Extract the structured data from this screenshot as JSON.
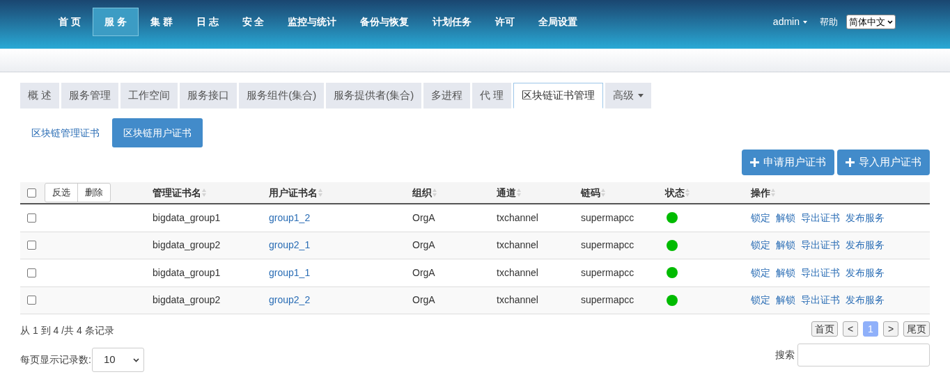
{
  "nav": {
    "items": [
      {
        "label": "首 页",
        "selected": false
      },
      {
        "label": "服 务",
        "selected": true
      },
      {
        "label": "集 群",
        "selected": false
      },
      {
        "label": "日 志",
        "selected": false
      },
      {
        "label": "安 全",
        "selected": false
      },
      {
        "label": "监控与统计",
        "selected": false
      },
      {
        "label": "备份与恢复",
        "selected": false
      },
      {
        "label": "计划任务",
        "selected": false
      },
      {
        "label": "许可",
        "selected": false
      },
      {
        "label": "全局设置",
        "selected": false
      }
    ],
    "user": "admin",
    "help": "帮助",
    "language": "简体中文"
  },
  "tabs": [
    {
      "label": "概 述",
      "selected": false
    },
    {
      "label": "服务管理",
      "selected": false
    },
    {
      "label": "工作空间",
      "selected": false
    },
    {
      "label": "服务接口",
      "selected": false
    },
    {
      "label": "服务组件(集合)",
      "selected": false
    },
    {
      "label": "服务提供者(集合)",
      "selected": false
    },
    {
      "label": "多进程",
      "selected": false
    },
    {
      "label": "代 理",
      "selected": false
    },
    {
      "label": "区块链证书管理",
      "selected": true
    },
    {
      "label": "高级",
      "selected": false,
      "kind": "dropdown"
    }
  ],
  "subtabs": [
    {
      "label": "区块链管理证书",
      "selected": false
    },
    {
      "label": "区块链用户证书",
      "selected": true
    }
  ],
  "actions": [
    "申请用户证书",
    "导入用户证书"
  ],
  "table": {
    "select_all_checked": false,
    "bulk_buttons": [
      "反选",
      "删除"
    ],
    "columns": [
      "管理证书名",
      "用户证书名",
      "组织",
      "通道",
      "链码",
      "状态",
      "操作"
    ],
    "rows": [
      {
        "checked": false,
        "admin_cert": "bigdata_group1",
        "user_cert": "group1_2",
        "org": "OrgA",
        "channel": "txchannel",
        "chaincode": "supermapcc",
        "color": "#00bb00",
        "operations": [
          "锁定",
          "解锁",
          "导出证书",
          "发布服务"
        ]
      },
      {
        "checked": false,
        "admin_cert": "bigdata_group2",
        "user_cert": "group2_1",
        "org": "OrgA",
        "channel": "txchannel",
        "chaincode": "supermapcc",
        "color": "#00bb00",
        "operations": [
          "锁定",
          "解锁",
          "导出证书",
          "发布服务"
        ]
      },
      {
        "checked": false,
        "admin_cert": "bigdata_group1",
        "user_cert": "group1_1",
        "org": "OrgA",
        "channel": "txchannel",
        "chaincode": "supermapcc",
        "color": "#00bb00",
        "operations": [
          "锁定",
          "解锁",
          "导出证书",
          "发布服务"
        ]
      },
      {
        "checked": false,
        "admin_cert": "bigdata_group2",
        "user_cert": "group2_2",
        "org": "OrgA",
        "channel": "txchannel",
        "chaincode": "supermapcc",
        "color": "#00bb00",
        "operations": [
          "锁定",
          "解锁",
          "导出证书",
          "发布服务"
        ]
      }
    ]
  },
  "summary": "从 1 到 4 /共 4 条记录",
  "pagination": [
    {
      "label": "首页",
      "selected": false
    },
    {
      "label": "<",
      "selected": false
    },
    {
      "label": "1",
      "selected": true
    },
    {
      "label": ">",
      "selected": false
    },
    {
      "label": "尾页",
      "selected": false
    }
  ],
  "page_size": {
    "label": "每页显示记录数:",
    "value": "10"
  },
  "search": {
    "label": "搜索"
  }
}
